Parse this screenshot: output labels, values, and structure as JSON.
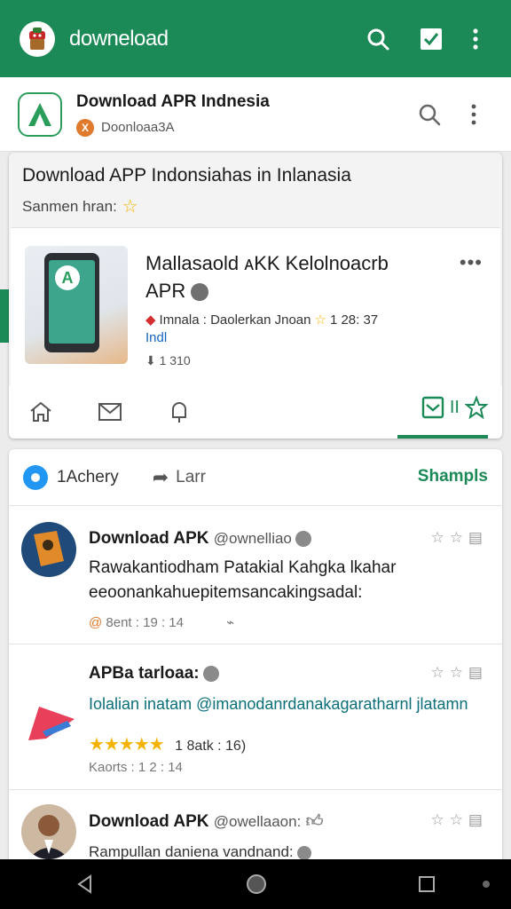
{
  "appbar": {
    "title": "downeload"
  },
  "subheader": {
    "title": "Download APR Indnesia",
    "meta": "Doonloaa3A",
    "meta_badge": "X"
  },
  "main_card": {
    "title": "Download APP Indonsiahas in Inlanasia",
    "subtitle": "Sanmen hran:",
    "app": {
      "name": "Mallasaold ᴀKK Kelolnoacrb APR",
      "more": "•••",
      "meta": "Imnala : Daolerkan Jnoan",
      "rating": "1 28: 37",
      "link": "Indl",
      "count": "1 310"
    }
  },
  "feed": {
    "tab1": "1Achery",
    "tab2": "Larr",
    "tab3": "Shampls",
    "posts": [
      {
        "name": "Download APK",
        "handle": "@ownelliao",
        "body": "Rawakantiodham Patakial Kahgka lkahar eeoonankahuepitemsancakingsadal:",
        "foot": "8ent : 19 : 14",
        "foot_icon": "@"
      },
      {
        "name": "APBa tarloaa:",
        "handle": "",
        "link": "Iolalian inatam @imanodanrdanakagaratharnl jlatamn",
        "stars": "★★★★★",
        "rating": "1 8atk : 16)",
        "foot": "Kaorts : 1 2 : 14"
      },
      {
        "name": "Download APK",
        "handle": "@owellaaon:",
        "body": "Rampullan daniena vandnand:"
      }
    ]
  },
  "colors": {
    "brand": "#1b8a57",
    "link": "#1565c0",
    "star": "#f5b301"
  }
}
